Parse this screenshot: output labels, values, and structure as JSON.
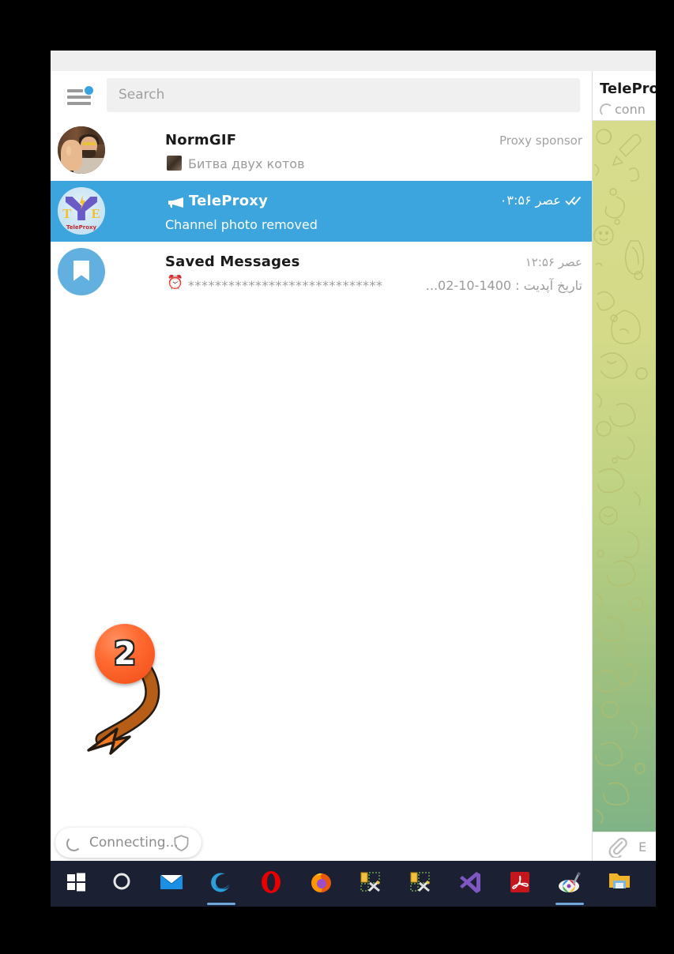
{
  "window": {
    "title": ""
  },
  "search": {
    "placeholder": "Search",
    "icon": "hamburger-menu-icon",
    "badge_color": "#3aa2e0"
  },
  "chat_list": [
    {
      "name": "NormGIF",
      "preview": "Битва двух котов",
      "meta": "Proxy sponsor",
      "avatar": "normgif-photo-avatar",
      "selected": false,
      "has_preview_thumb": true
    },
    {
      "name": "TeleProxy",
      "preview": "Channel photo removed",
      "meta": "عصر ۰۳:۵۶",
      "avatar": "teleproxy-logo-avatar",
      "selected": true,
      "channel_icon": "megaphone-icon",
      "read_status": "double-check-icon"
    },
    {
      "name": "Saved Messages",
      "preview_stars": "*****************************",
      "preview_rtl": "تاریخ آپدیت : 1400-10-02...",
      "preview_emoji": "⏰",
      "meta": "عصر ۱۲:۵۶",
      "avatar": "saved-messages-bookmark-avatar",
      "selected": false
    }
  ],
  "right_pane": {
    "title": "TelePro",
    "status": "conn",
    "message_placeholder": "E",
    "attach_icon": "paperclip-icon",
    "wallpaper_colors": [
      "#d7dc8c",
      "#bcd183",
      "#7fb386"
    ]
  },
  "connection": {
    "label": "Connecting...",
    "shield_icon": "shield-icon",
    "spinner": "loading-spinner"
  },
  "annotation": {
    "number": "2",
    "color": "#f5551c",
    "arrow": "curved-arrow-down-left"
  },
  "taskbar": {
    "items": [
      {
        "name": "windows-start-icon",
        "label": "Start",
        "active": false
      },
      {
        "name": "cortana-icon",
        "label": "Cortana",
        "active": false
      },
      {
        "name": "mail-icon",
        "label": "Mail",
        "active": false
      },
      {
        "name": "microsoft-edge-icon",
        "label": "Microsoft Edge",
        "active": true
      },
      {
        "name": "opera-icon",
        "label": "Opera",
        "active": false
      },
      {
        "name": "firefox-icon",
        "label": "Firefox",
        "active": false
      },
      {
        "name": "build-tool-icon",
        "label": "Build Tool",
        "active": false
      },
      {
        "name": "build-tool-icon-2",
        "label": "Build Tool",
        "active": false
      },
      {
        "name": "visual-studio-icon",
        "label": "Visual Studio",
        "active": false
      },
      {
        "name": "adobe-acrobat-icon",
        "label": "Adobe Acrobat",
        "active": false
      },
      {
        "name": "paint-icon",
        "label": "Paint",
        "active": true
      },
      {
        "name": "file-explorer-icon",
        "label": "File Explorer",
        "active": false
      }
    ]
  }
}
